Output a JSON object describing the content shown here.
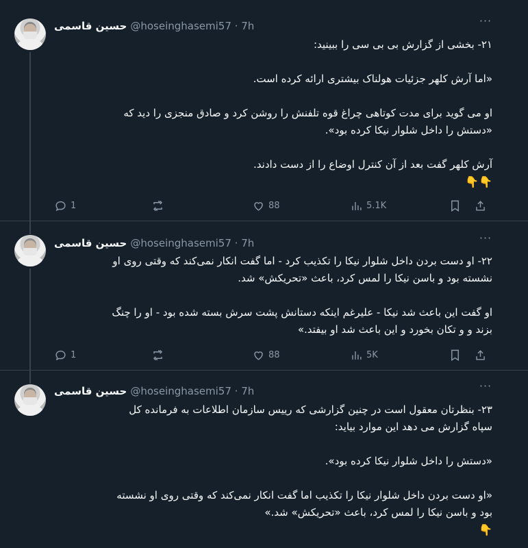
{
  "tweets": [
    {
      "name": "حسین قاسمی",
      "handle": "@hoseinghasemi57 · 7h",
      "lines": [
        "۲۱- بخشی از گزارش بی بی سی را ببینید:",
        "",
        "«اما آرش کلهر جزئیات هولناک بیشتری ارائه کرده است.",
        "",
        "او می گوید برای مدت کوتاهی چراغ قوه تلفنش را روشن کرد و صادق منجزی را دید که",
        "«دستش را داخل شلوار نیکا کرده بود».",
        "",
        "آرش کلهر گفت بعد از آن کنترل اوضاع را از دست دادند."
      ],
      "emoji": "👇👇",
      "replies": "1",
      "retweets": "",
      "likes": "88",
      "views": "5.1K"
    },
    {
      "name": "حسین قاسمی",
      "handle": "@hoseinghasemi57 · 7h",
      "lines": [
        "۲۲- او دست بردن داخل شلوار نیکا را تکذیب کرد - اما گفت انکار نمی‌کند که وقتی روی او",
        "نشسته بود و باسن نیکا را لمس کرد، باعث «تحریکش» شد.",
        "",
        "او گفت این باعث شد نیکا - علیرغم اینکه دستانش پشت سرش بسته شده بود - او را چنگ",
        "بزند و و تکان بخورد و این باعث شد او بیفتد.»"
      ],
      "emoji": "",
      "replies": "1",
      "retweets": "",
      "likes": "88",
      "views": "5K"
    },
    {
      "name": "حسین قاسمی",
      "handle": "@hoseinghasemi57 · 7h",
      "lines": [
        "۲۳- بنظرتان معقول است در چنین گزارشی که رییس سازمان اطلاعات به فرمانده کل",
        "سپاه گزارش می دهد  این موارد بیاید:",
        "",
        "«دستش را داخل شلوار نیکا کرده بود».",
        "",
        "«او دست بردن داخل شلوار نیکا را تکذیب اما گفت انکار نمی‌کند که وقتی روی او نشسته",
        "بود و باسن نیکا را لمس کرد، باعث «تحریکش» شد.»"
      ],
      "emoji": "👇",
      "replies": "",
      "retweets": "",
      "likes": "",
      "views": ""
    }
  ],
  "icons": {
    "more": "more-horizontal-icon",
    "reply": "reply-icon",
    "retweet": "retweet-icon",
    "like": "heart-icon",
    "views": "views-chart-icon",
    "bookmark": "bookmark-icon",
    "share": "share-icon"
  },
  "colors": {
    "background": "#15202b",
    "text": "#f7f9f9",
    "secondary": "#8b98a5",
    "border": "#38444d"
  }
}
